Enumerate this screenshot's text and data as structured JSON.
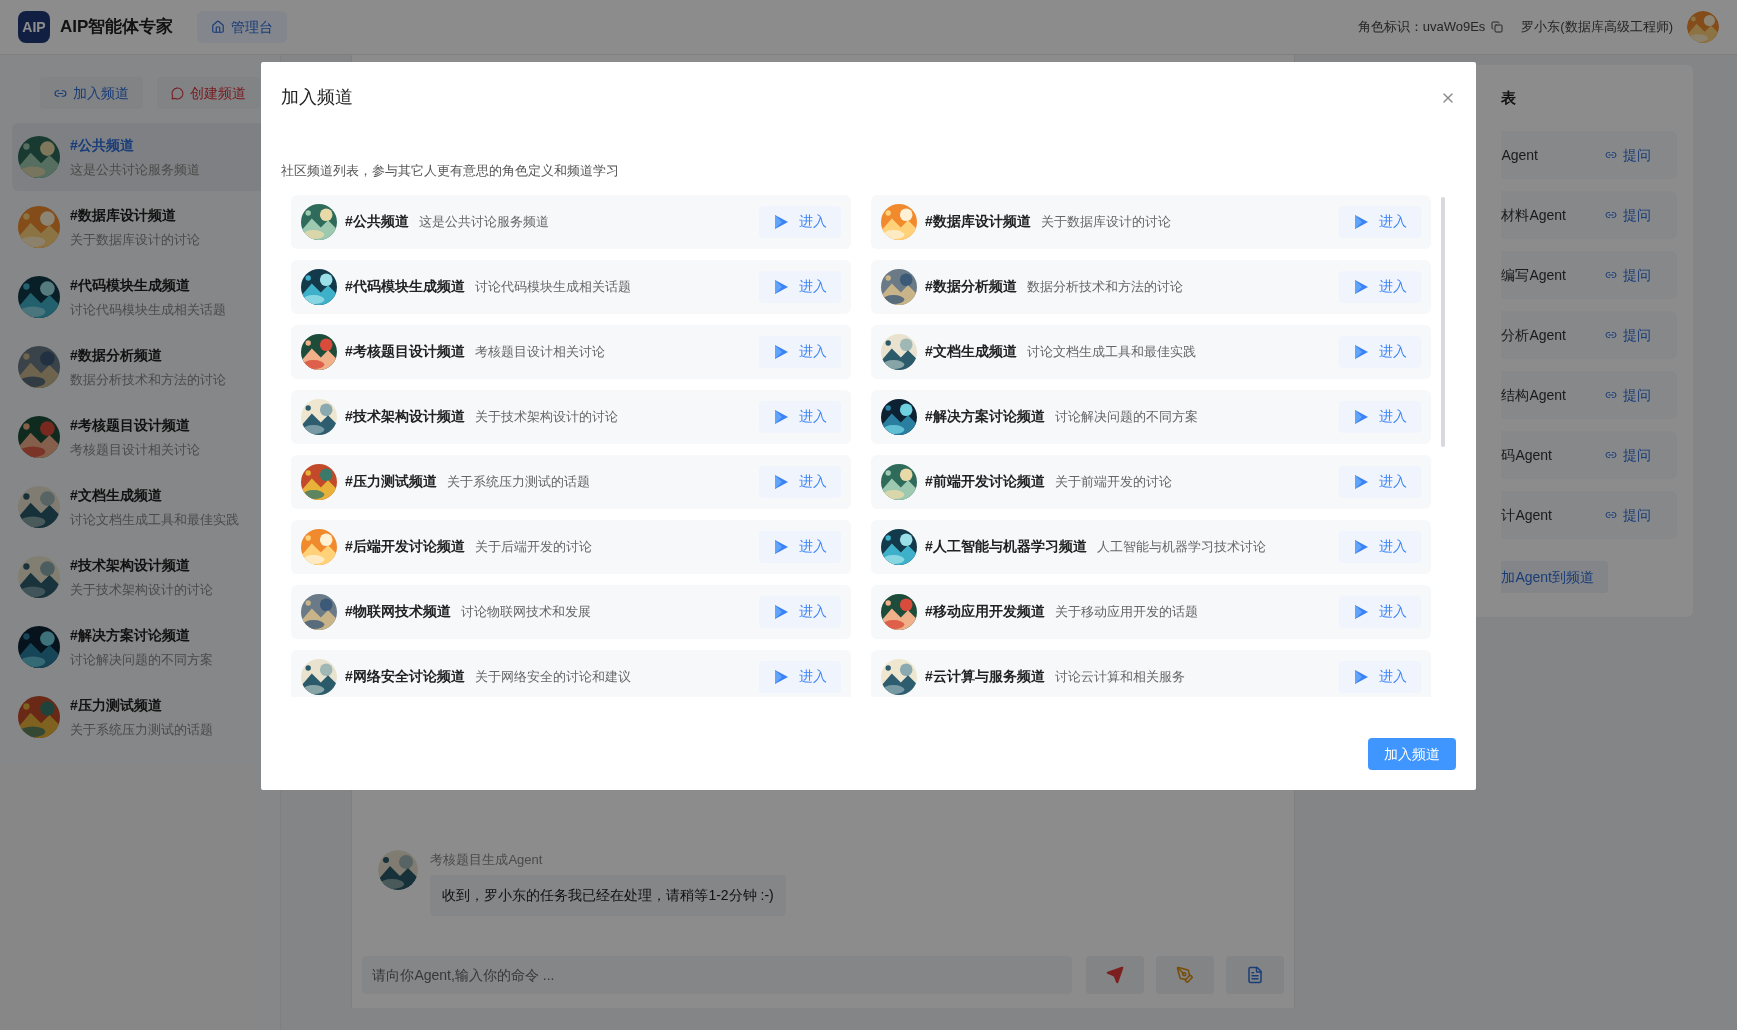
{
  "header": {
    "logo": "AIP",
    "title": "AIP智能体专家",
    "nav_tab": {
      "label": "管理台",
      "selected": true
    },
    "role_id": "角色标识：uvaWo9Es",
    "user": "罗小东(数据库高级工程师)"
  },
  "sidebar": {
    "buttons": [
      {
        "label": "加入频道",
        "kind": "join"
      },
      {
        "label": "创建频道",
        "kind": "create"
      }
    ],
    "channels": [
      {
        "name": "#公共频道",
        "description": "这是公共讨论服务频道",
        "selected": true
      },
      {
        "name": "#数据库设计频道",
        "description": "关于数据库设计的讨论",
        "selected": false
      },
      {
        "name": "#代码模块生成频道",
        "description": "讨论代码模块生成相关话题",
        "selected": false
      },
      {
        "name": "#数据分析频道",
        "description": "数据分析技术和方法的讨论",
        "selected": false
      },
      {
        "name": "#考核题目设计频道",
        "description": "考核题目设计相关讨论",
        "selected": false
      },
      {
        "name": "#文档生成频道",
        "description": "讨论文档生成工具和最佳实践",
        "selected": false
      },
      {
        "name": "#技术架构设计频道",
        "description": "关于技术架构设计的讨论",
        "selected": false
      },
      {
        "name": "#解决方案讨论频道",
        "description": "讨论解决问题的不同方案",
        "selected": false
      },
      {
        "name": "#压力测试频道",
        "description": "关于系统压力测试的话题",
        "selected": false
      }
    ]
  },
  "chat": {
    "messages": [
      {
        "sender": "考核题目生成Agent",
        "text": "收到，罗小东的任务我已经在处理，请稍等1-2分钟 :-)"
      }
    ],
    "input": {
      "placeholder": "请向你Agent,输入你的命令 ..."
    }
  },
  "agents_panel": {
    "title": "表",
    "agents": [
      {
        "name": "Agent",
        "action": "提问"
      },
      {
        "name": "材料Agent",
        "action": "提问"
      },
      {
        "name": "编写Agent",
        "action": "提问"
      },
      {
        "name": "分析Agent",
        "action": "提问"
      },
      {
        "name": "结构Agent",
        "action": "提问"
      },
      {
        "name": "码Agent",
        "action": "提问"
      },
      {
        "name": "计Agent",
        "action": "提问"
      }
    ],
    "add_button": "加Agent到频道"
  },
  "dialog": {
    "title": "加入频道",
    "subtitle": "社区频道列表，参与其它人更有意思的角色定义和频道学习",
    "confirm_button": "加入频道",
    "channels": [
      {
        "name": "#公共频道",
        "description": "这是公共讨论服务频道",
        "action": "进入"
      },
      {
        "name": "#数据库设计频道",
        "description": "关于数据库设计的讨论",
        "action": "进入"
      },
      {
        "name": "#代码模块生成频道",
        "description": "讨论代码模块生成相关话题",
        "action": "进入"
      },
      {
        "name": "#数据分析频道",
        "description": "数据分析技术和方法的讨论",
        "action": "进入"
      },
      {
        "name": "#考核题目设计频道",
        "description": "考核题目设计相关讨论",
        "action": "进入"
      },
      {
        "name": "#文档生成频道",
        "description": "讨论文档生成工具和最佳实践",
        "action": "进入"
      },
      {
        "name": "#技术架构设计频道",
        "description": "关于技术架构设计的讨论",
        "action": "进入"
      },
      {
        "name": "#解决方案讨论频道",
        "description": "讨论解决问题的不同方案",
        "action": "进入"
      },
      {
        "name": "#压力测试频道",
        "description": "关于系统压力测试的话题",
        "action": "进入"
      },
      {
        "name": "#前端开发讨论频道",
        "description": "关于前端开发的讨论",
        "action": "进入"
      },
      {
        "name": "#后端开发讨论频道",
        "description": "关于后端开发的讨论",
        "action": "进入"
      },
      {
        "name": "#人工智能与机器学习频道",
        "description": "人工智能与机器学习技术讨论",
        "action": "进入"
      },
      {
        "name": "#物联网技术频道",
        "description": "讨论物联网技术和发展",
        "action": "进入"
      },
      {
        "name": "#移动应用开发频道",
        "description": "关于移动应用开发的话题",
        "action": "进入"
      },
      {
        "name": "#网络安全讨论频道",
        "description": "关于网络安全的讨论和建议",
        "action": "进入"
      },
      {
        "name": "#云计算与服务频道",
        "description": "讨论云计算和相关服务",
        "action": "进入"
      }
    ]
  }
}
